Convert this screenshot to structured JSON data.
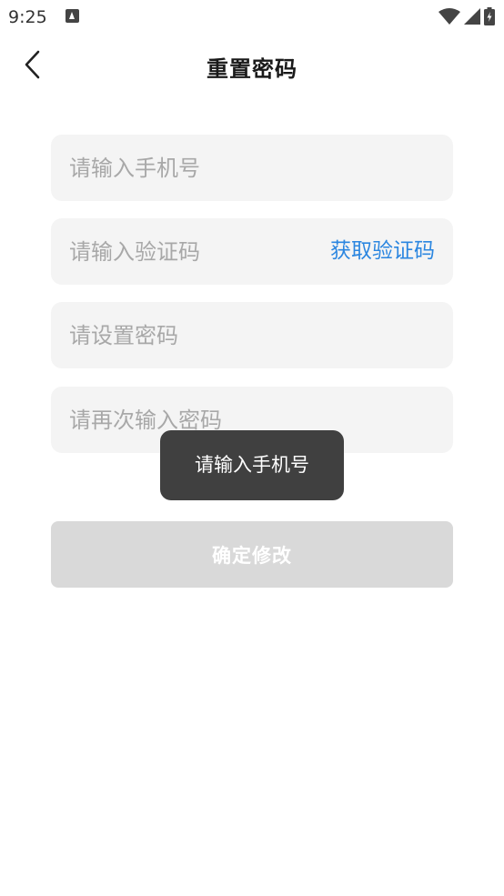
{
  "status_bar": {
    "time": "9:25",
    "icons": [
      "app-notification-icon",
      "wifi-icon",
      "signal-icon",
      "battery-charging-icon"
    ]
  },
  "header": {
    "title": "重置密码",
    "back_icon": "chevron-left-icon"
  },
  "form": {
    "phone_placeholder": "请输入手机号",
    "code_placeholder": "请输入验证码",
    "get_code_label": "获取验证码",
    "password_placeholder": "请设置密码",
    "confirm_password_placeholder": "请再次输入密码",
    "submit_label": "确定修改"
  },
  "toast": {
    "message": "请输入手机号"
  },
  "colors": {
    "accent": "#2b86e0",
    "field_bg": "#f4f4f4",
    "button_disabled": "#d9d9d9",
    "placeholder": "#a8a8a8",
    "toast_bg": "#323232"
  }
}
